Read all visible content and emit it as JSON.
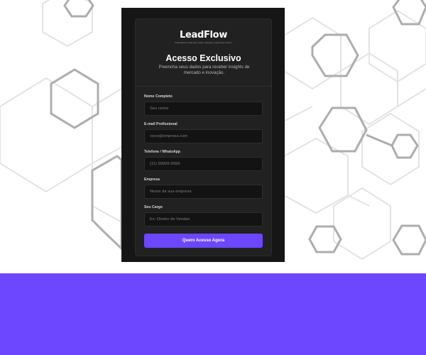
{
  "brand": {
    "name": "LeadFlow",
    "tagline": "Aceleração de vendas para o varejo, marketing e negócios que crescem"
  },
  "form": {
    "title": "Acesso Exclusivo",
    "subtitle": "Preencha seus dados para receber insights de mercado e inovação.",
    "fields": [
      {
        "label": "Nome Completo",
        "placeholder": "Seu nome"
      },
      {
        "label": "E-mail Profissional",
        "placeholder": "voce@empresa.com"
      },
      {
        "label": "Telefone / WhatsApp",
        "placeholder": "(11) 99999-9999"
      },
      {
        "label": "Empresa",
        "placeholder": "Nome da sua empresa"
      },
      {
        "label": "Seu Cargo",
        "placeholder": "Ex: Diretor de Vendas"
      }
    ],
    "submit_label": "Quero Acesso Agora"
  },
  "colors": {
    "accent": "#6c47ff",
    "panel": "#161616",
    "card": "#212121",
    "field": "#131313",
    "page_background": "#ffffff"
  }
}
